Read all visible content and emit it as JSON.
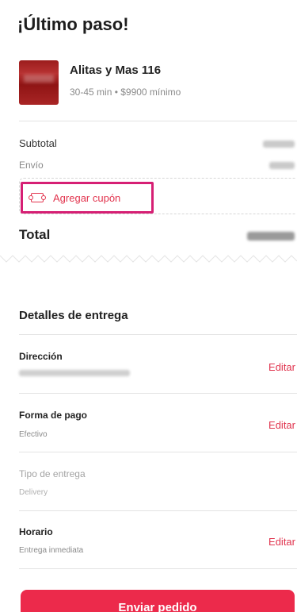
{
  "page": {
    "title": "¡Último paso!"
  },
  "restaurant": {
    "name": "Alitas y Mas 116",
    "meta": "30-45 min • $9900 mínimo"
  },
  "summary": {
    "subtotal_label": "Subtotal",
    "shipping_label": "Envío",
    "coupon_label": "Agregar cupón",
    "total_label": "Total"
  },
  "delivery": {
    "section_title": "Detalles de entrega",
    "address": {
      "title": "Dirección",
      "edit": "Editar"
    },
    "payment": {
      "title": "Forma de pago",
      "value": "Efectivo",
      "edit": "Editar"
    },
    "delivery_type": {
      "title": "Tipo de entrega",
      "value": "Delivery"
    },
    "schedule": {
      "title": "Horario",
      "value": "Entrega inmediata",
      "edit": "Editar"
    }
  },
  "actions": {
    "submit_label": "Enviar pedido"
  },
  "colors": {
    "accent": "#e2344e",
    "highlight": "#d61f74",
    "button": "#ec2a4b"
  },
  "icons": {
    "coupon": "ticket-icon"
  }
}
